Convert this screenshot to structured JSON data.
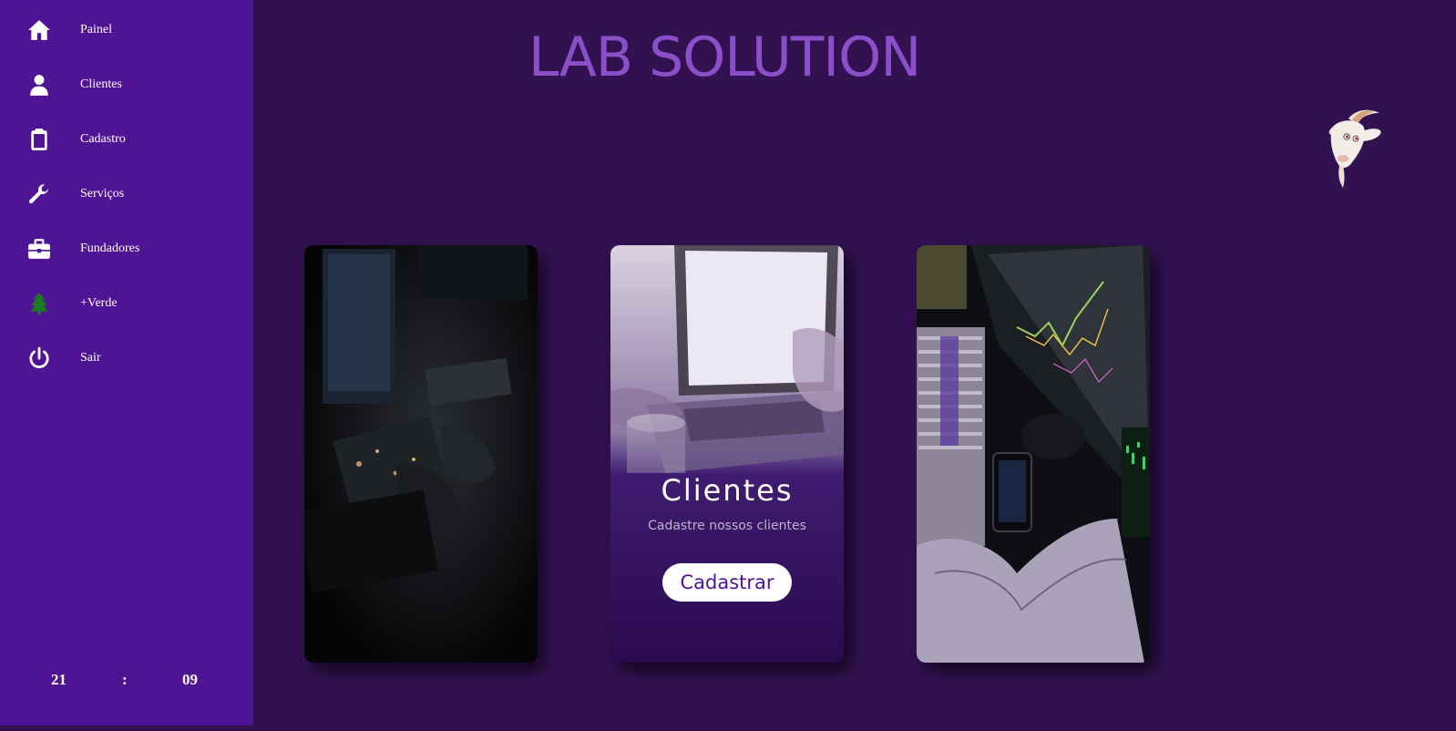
{
  "app": {
    "title": "LAB SOLUTION"
  },
  "sidebar": {
    "items": [
      {
        "label": "Painel",
        "icon": "home-icon"
      },
      {
        "label": "Clientes",
        "icon": "user-icon"
      },
      {
        "label": "Cadastro",
        "icon": "clipboard-icon"
      },
      {
        "label": "Serviços",
        "icon": "wrench-icon"
      },
      {
        "label": "Fundadores",
        "icon": "briefcase-icon"
      },
      {
        "label": "+Verde",
        "icon": "tree-icon"
      },
      {
        "label": "Sair",
        "icon": "power-icon"
      }
    ],
    "clock": {
      "hours": "21",
      "separator": ":",
      "minutes": "09"
    }
  },
  "cards": [
    {
      "image": "hardware-workbench-photo"
    },
    {
      "image": "laptop-photo",
      "title": "Clientes",
      "subtitle": "Cadastre nossos clientes",
      "button_label": "Cadastrar"
    },
    {
      "image": "trading-money-photo"
    }
  ],
  "colors": {
    "background": "#311150",
    "sidebar": "#4f1493",
    "title": "#8a4fc9",
    "tree_icon": "#1e7a1e",
    "button_text": "#4f1493"
  }
}
